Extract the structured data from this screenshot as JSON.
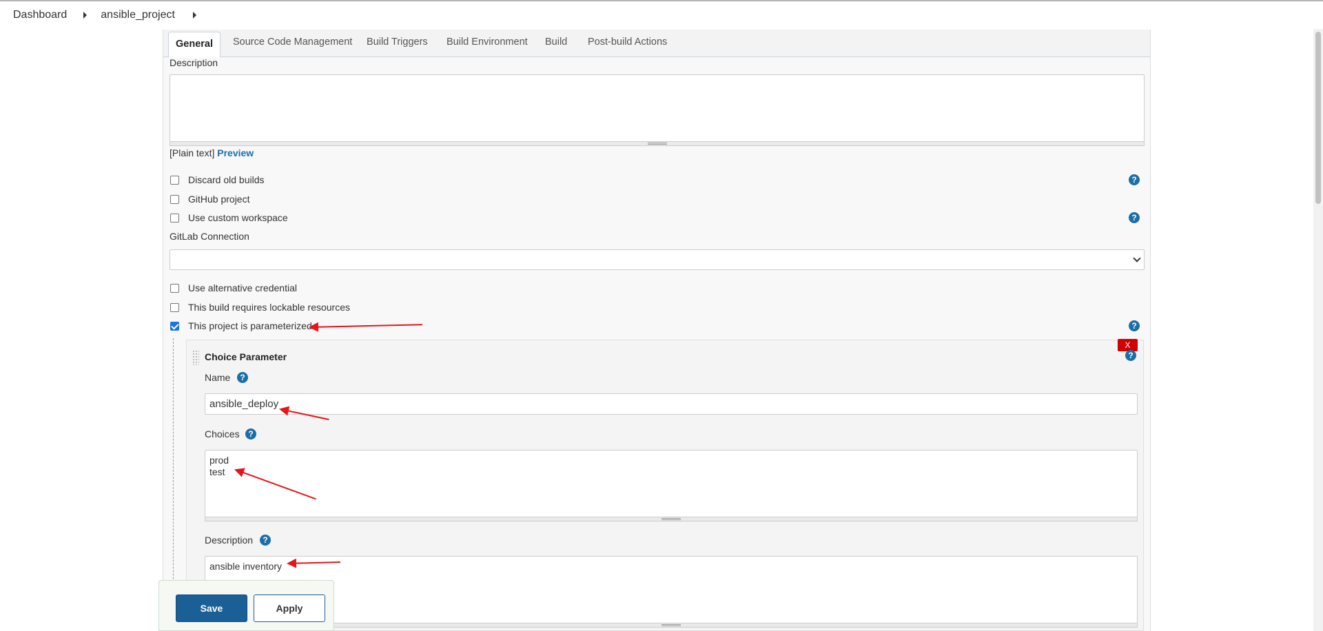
{
  "breadcrumb": {
    "items": [
      "Dashboard",
      "ansible_project"
    ]
  },
  "tabs": [
    "General",
    "Source Code Management",
    "Build Triggers",
    "Build Environment",
    "Build",
    "Post-build Actions"
  ],
  "general": {
    "description_label": "Description",
    "description_value": "",
    "plain_text": "[Plain text]",
    "preview": "Preview",
    "options": [
      {
        "label": "Discard old builds",
        "checked": false
      },
      {
        "label": "GitHub project",
        "checked": false
      },
      {
        "label": "Use custom workspace",
        "checked": false
      }
    ],
    "gitlab_connection_label": "GitLab Connection",
    "gitlab_connection_value": "",
    "options2": [
      {
        "label": "Use alternative credential",
        "checked": false
      },
      {
        "label": "This build requires lockable resources",
        "checked": false
      },
      {
        "label": "This project is parameterized",
        "checked": true
      }
    ]
  },
  "choice_parameter": {
    "title": "Choice Parameter",
    "delete": "X",
    "name_label": "Name",
    "name_value": "ansible_deploy",
    "choices_label": "Choices",
    "choices_value": "prod\ntest",
    "description_label": "Description",
    "description_value": "ansible inventory"
  },
  "footer": {
    "save": "Save",
    "apply": "Apply"
  },
  "help_icon": "?",
  "colors": {
    "accent": "#1b6ea8",
    "primary_button": "#1b5f97",
    "delete": "#d00000",
    "annotation_arrow": "#e8141a"
  }
}
